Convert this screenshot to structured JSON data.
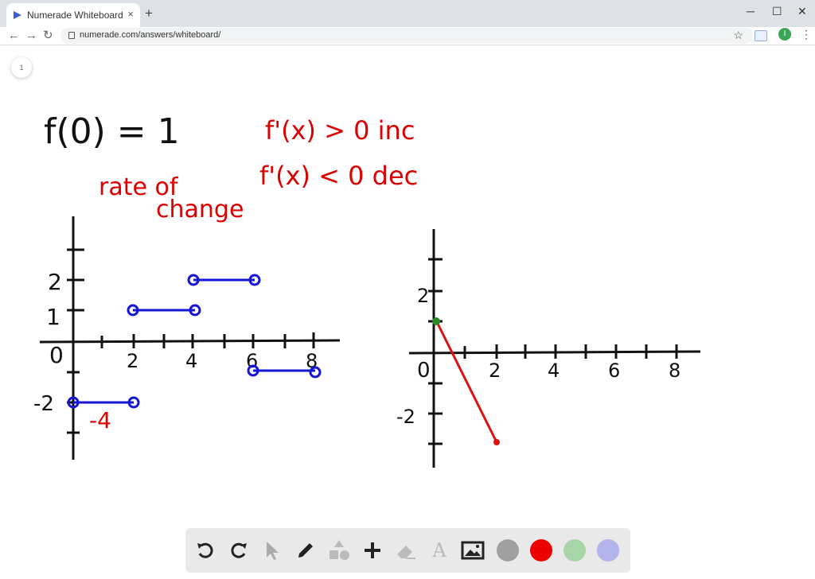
{
  "browser": {
    "tab_title": "Numerade Whiteboard",
    "tab_close": "×",
    "new_tab": "+",
    "url": "numerade.com/answers/whiteboard/",
    "window_minimize": "─",
    "window_maximize": "☐",
    "window_close": "✕",
    "back": "←",
    "forward": "→",
    "reload": "↻",
    "bookmark_star": "☆",
    "profile_initial": "I",
    "menu": "⋮"
  },
  "page_indicator": "1",
  "whiteboard": {
    "notes": {
      "f0": "f(0) = 1",
      "inc": "f'(x) > 0 inc",
      "dec": "f'(x) < 0 dec",
      "rate_line1": "rate of",
      "rate_line2": "change",
      "neg_four": "-4"
    },
    "left_graph": {
      "x_tick_labels": [
        "0",
        "2",
        "4",
        "6",
        "8"
      ],
      "y_tick_labels": [
        "2",
        "1",
        "-2"
      ]
    },
    "right_graph": {
      "x_tick_labels": [
        "0",
        "2",
        "4",
        "6",
        "8"
      ],
      "y_tick_labels": [
        "2",
        "-2"
      ]
    }
  },
  "toolbar": {
    "tools": [
      "undo-icon",
      "redo-icon",
      "pointer-icon",
      "pencil-icon",
      "shapes-icon",
      "plus-icon",
      "eraser-icon",
      "text-icon",
      "image-icon"
    ],
    "text_tool_label": "A",
    "colors": [
      "#a0a0a0",
      "#ee0000",
      "#a9d6a9",
      "#b3b3ee"
    ]
  }
}
